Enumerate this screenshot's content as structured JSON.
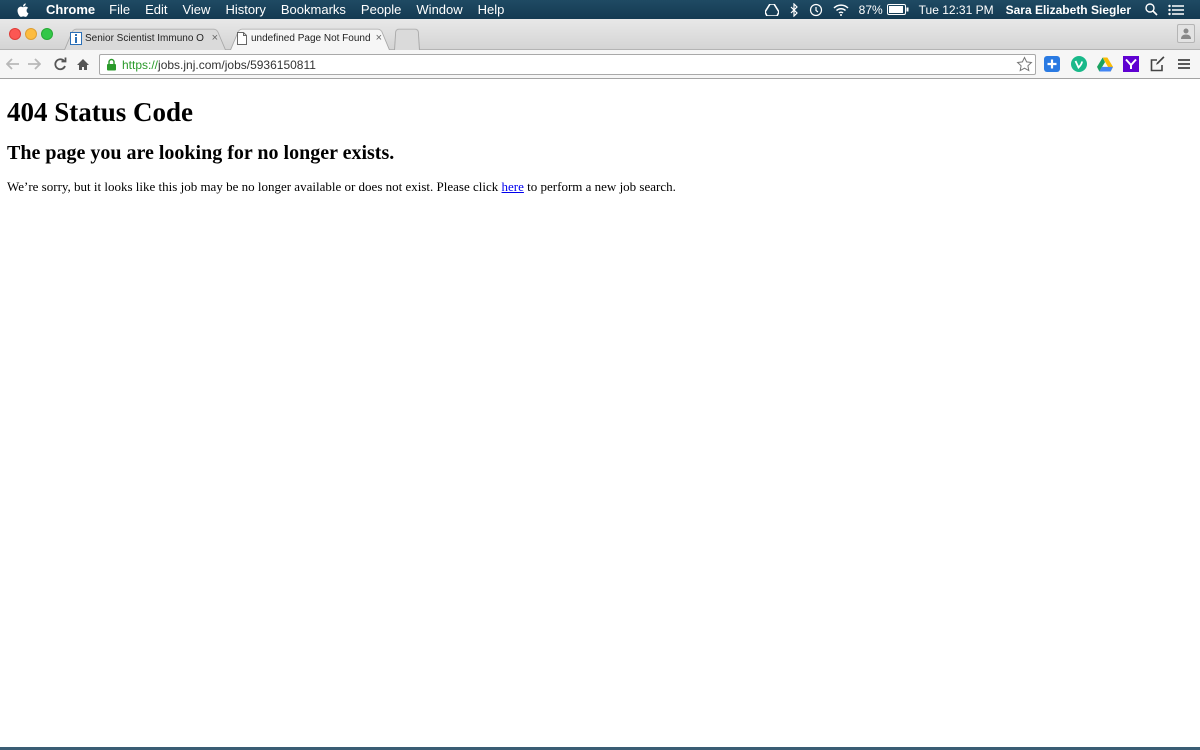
{
  "menubar": {
    "app_name": "Chrome",
    "menus": [
      "File",
      "Edit",
      "View",
      "History",
      "Bookmarks",
      "People",
      "Window",
      "Help"
    ],
    "battery": "87%",
    "clock": "Tue 12:31 PM",
    "user": "Sara Elizabeth Siegler"
  },
  "tabs": [
    {
      "title": "Senior Scientist Immuno O",
      "close": "×",
      "favicon": "info-icon"
    },
    {
      "title": "undefined Page Not Found",
      "close": "×",
      "favicon": "page-icon"
    }
  ],
  "toolbar": {
    "url_scheme": "https://",
    "url_rest": "jobs.jnj.com/jobs/5936150811"
  },
  "page": {
    "heading": "404 Status Code",
    "subheading": "The page you are looking for no longer exists.",
    "message_before": "We’re sorry, but it looks like this job may be no longer available or does not exist. Please click ",
    "link_text": "here",
    "message_after": " to perform a new job search."
  },
  "colors": {
    "menubar": "#1f4a63",
    "link": "#0000ee",
    "secure": "#2a9a2a"
  }
}
